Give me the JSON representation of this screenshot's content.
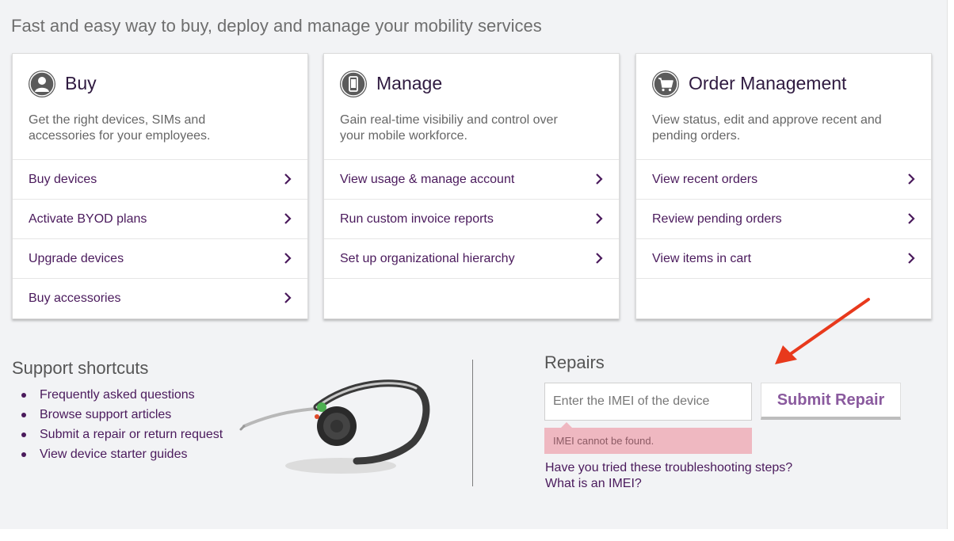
{
  "tagline": "Fast and easy way to buy, deploy and manage your mobility services",
  "cards": [
    {
      "icon": "person-icon",
      "title": "Buy",
      "description": "Get the right devices, SIMs and accessories for your employees.",
      "links": [
        "Buy devices",
        "Activate BYOD plans",
        "Upgrade devices",
        "Buy accessories"
      ]
    },
    {
      "icon": "phone-icon",
      "title": "Manage",
      "description": "Gain real-time visibiliy and control over your mobile workforce.",
      "links": [
        "View usage & manage account",
        "Run custom invoice reports",
        "Set up organizational hierarchy"
      ]
    },
    {
      "icon": "cart-icon",
      "title": "Order Management",
      "description": "View status, edit and approve recent and pending orders.",
      "links": [
        "View recent orders",
        "Review pending orders",
        "View items in cart"
      ]
    }
  ],
  "support": {
    "title": "Support shortcuts",
    "items": [
      "Frequently asked questions",
      "Browse support articles",
      "Submit a repair or return request",
      "View device starter guides"
    ]
  },
  "repairs": {
    "title": "Repairs",
    "input_placeholder": "Enter the IMEI of the device",
    "input_value": "",
    "submit_label": "Submit Repair",
    "error": "IMEI cannot be found.",
    "help_links": [
      "Have you tried these troubleshooting steps?",
      "What is an IMEI?"
    ]
  },
  "colors": {
    "link": "#4a1a5c",
    "accent": "#8a5a9e",
    "error_bg": "#efb8c1",
    "annotation_arrow": "#e8391c"
  }
}
